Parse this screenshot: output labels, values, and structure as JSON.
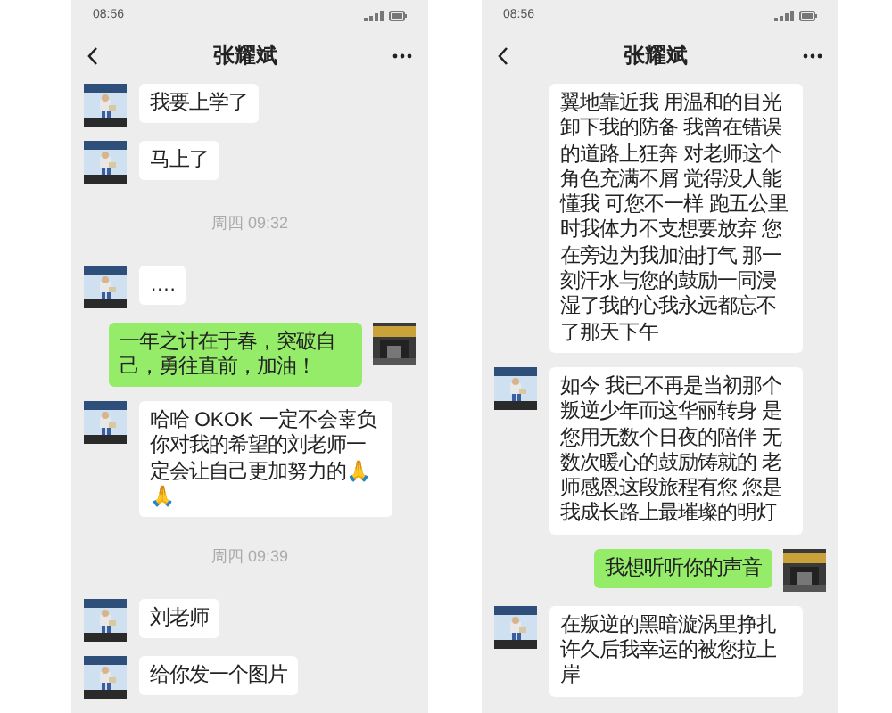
{
  "phones": [
    {
      "status_time": "08:56",
      "title": "张耀斌",
      "messages": [
        {
          "kind": "received",
          "avatar_shown": true,
          "text": "我要上学了"
        },
        {
          "kind": "received",
          "avatar_shown": true,
          "text": "马上了"
        },
        {
          "kind": "time",
          "text": "周四 09:32"
        },
        {
          "kind": "received",
          "avatar_shown": true,
          "text": "…."
        },
        {
          "kind": "sent",
          "text": "一年之计在于春，突破自己，勇往直前，加油！"
        },
        {
          "kind": "received",
          "avatar_shown": true,
          "text": "哈哈 OKOK 一定不会辜负你对我的希望的刘老师一定会让自己更加努力的🙏🙏"
        },
        {
          "kind": "time",
          "text": "周四 09:39"
        },
        {
          "kind": "received",
          "avatar_shown": true,
          "text": "刘老师"
        },
        {
          "kind": "received",
          "avatar_shown": true,
          "text": "给你发一个图片"
        }
      ]
    },
    {
      "status_time": "08:56",
      "title": "张耀斌",
      "messages": [
        {
          "kind": "received",
          "avatar_shown": false,
          "text": "翼地靠近我 用温和的目光卸下我的防备 我曾在错误的道路上狂奔 对老师这个角色充满不屑 觉得没人能懂我 可您不一样 跑五公里时我体力不支想要放弃 您在旁边为我加油打气 那一刻汗水与您的鼓励一同浸湿了我的心我永远都忘不了那天下午"
        },
        {
          "kind": "received",
          "avatar_shown": true,
          "text": "如今 我已不再是当初那个叛逆少年而这华丽转身 是您用无数个日夜的陪伴 无数次暖心的鼓励铸就的 老师感恩这段旅程有您 您是我成长路上最璀璨的明灯"
        },
        {
          "kind": "sent",
          "text": "我想听听你的声音"
        },
        {
          "kind": "received",
          "avatar_shown": true,
          "text": "在叛逆的黑暗漩涡里挣扎许久后我幸运的被您拉上岸"
        }
      ]
    }
  ]
}
